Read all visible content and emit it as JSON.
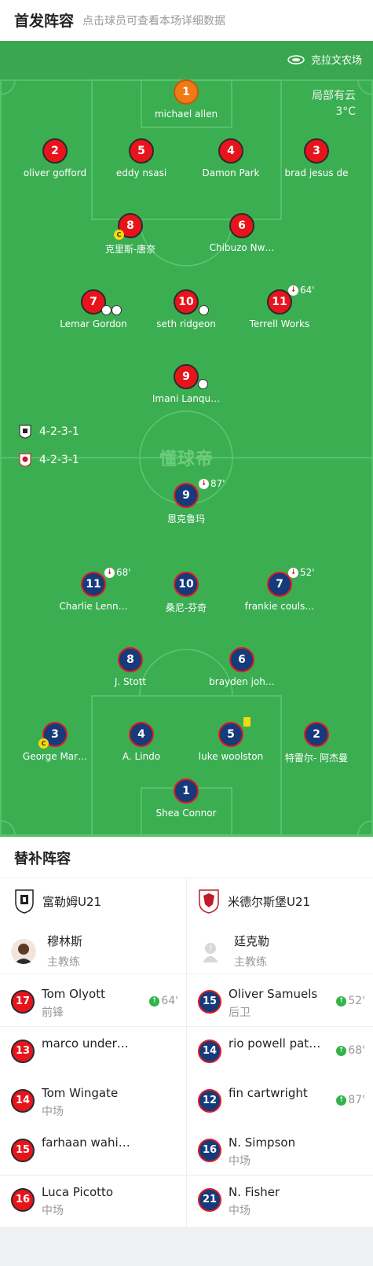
{
  "header": {
    "title": "首发阵容",
    "subtitle": "点击球员可查看本场详细数据"
  },
  "pitch": {
    "venue": "克拉文农场",
    "weather": "局部有云",
    "temperature": "3°C",
    "watermark": "懂球帝",
    "home_formation": "4-2-3-1",
    "away_formation": "4-2-3-1",
    "colors": {
      "pitch": "#3cae52",
      "home_shirt": "#e8141c",
      "home_keeper": "#f07a16",
      "away_shirt": "#163a7a"
    }
  },
  "home_players": [
    {
      "number": "1",
      "name": "michael allen"
    },
    {
      "number": "2",
      "name": "oliver gofford"
    },
    {
      "number": "5",
      "name": "eddy nsasi"
    },
    {
      "number": "4",
      "name": "Damon Park"
    },
    {
      "number": "3",
      "name": "brad jesus de"
    },
    {
      "number": "8",
      "name": "克里斯-唐奈"
    },
    {
      "number": "6",
      "name": "Chibuzo Nw…"
    },
    {
      "number": "7",
      "name": "Lemar Gordon"
    },
    {
      "number": "10",
      "name": "seth ridgeon"
    },
    {
      "number": "11",
      "name": "Terrell Works",
      "sub_minute": "64'"
    },
    {
      "number": "9",
      "name": "Imani Lanqu…"
    }
  ],
  "away_players": [
    {
      "number": "9",
      "name": "恩克鲁玛",
      "sub_minute": "87'"
    },
    {
      "number": "11",
      "name": "Charlie Lenn…",
      "sub_minute": "68'"
    },
    {
      "number": "10",
      "name": "桑尼-芬奇"
    },
    {
      "number": "7",
      "name": "frankie couls…",
      "sub_minute": "52'"
    },
    {
      "number": "8",
      "name": "J. Stott"
    },
    {
      "number": "6",
      "name": "brayden joh…"
    },
    {
      "number": "3",
      "name": "George Mar…"
    },
    {
      "number": "4",
      "name": "A. Lindo"
    },
    {
      "number": "5",
      "name": "luke woolston"
    },
    {
      "number": "2",
      "name": "特雷尔- 阿杰曼"
    },
    {
      "number": "1",
      "name": "Shea Connor"
    }
  ],
  "subs": {
    "title": "替补阵容",
    "home_team": "富勒姆U21",
    "away_team": "米德尔斯堡U21",
    "home_coach": {
      "name": "穆林斯",
      "role": "主教练"
    },
    "away_coach": {
      "name": "廷克勒",
      "role": "主教练"
    },
    "home_list": [
      {
        "number": "17",
        "name": "Tom Olyott",
        "pos": "前锋",
        "minute": "64'"
      },
      {
        "number": "13",
        "name": "marco under…",
        "pos": "",
        "minute": ""
      },
      {
        "number": "14",
        "name": "Tom Wingate",
        "pos": "中场",
        "minute": ""
      },
      {
        "number": "15",
        "name": "farhaan wahid…",
        "pos": "",
        "minute": ""
      },
      {
        "number": "16",
        "name": "Luca Picotto",
        "pos": "中场",
        "minute": ""
      }
    ],
    "away_list": [
      {
        "number": "15",
        "name": "Oliver Samuels",
        "pos": "后卫",
        "minute": "52'"
      },
      {
        "number": "14",
        "name": "rio powell patt…",
        "pos": "",
        "minute": "68'"
      },
      {
        "number": "12",
        "name": "fin cartwright",
        "pos": "",
        "minute": "87'"
      },
      {
        "number": "16",
        "name": "N. Simpson",
        "pos": "中场",
        "minute": ""
      },
      {
        "number": "21",
        "name": "N. Fisher",
        "pos": "中场",
        "minute": ""
      }
    ]
  }
}
